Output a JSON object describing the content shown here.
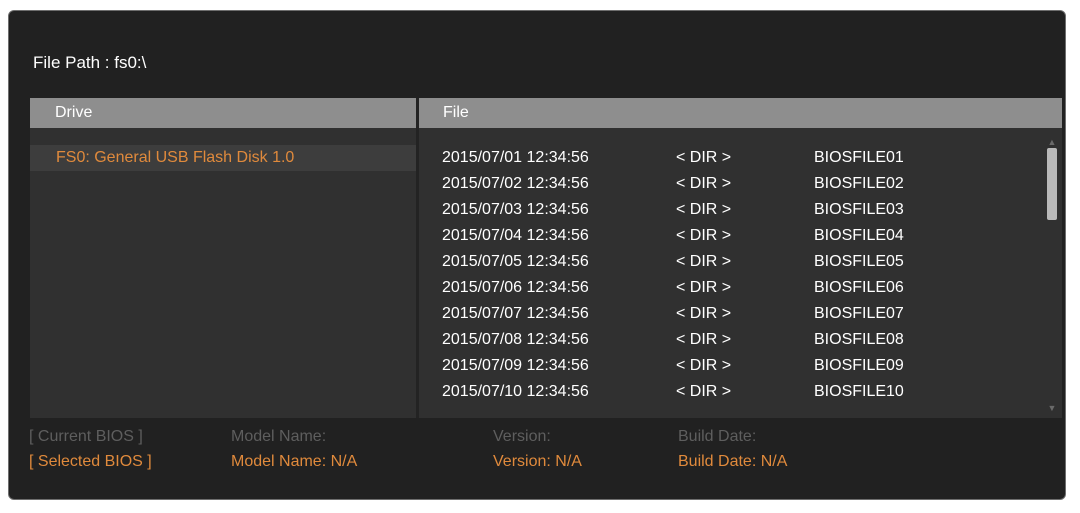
{
  "file_path": "File Path : fs0:\\",
  "headers": {
    "drive": "Drive",
    "file": "File"
  },
  "drives": [
    "FS0: General USB Flash Disk 1.0"
  ],
  "files": [
    {
      "date": "2015/07/01 12:34:56",
      "type": "< DIR >",
      "name": "BIOSFILE01"
    },
    {
      "date": "2015/07/02 12:34:56",
      "type": "< DIR >",
      "name": "BIOSFILE02"
    },
    {
      "date": "2015/07/03 12:34:56",
      "type": "< DIR >",
      "name": "BIOSFILE03"
    },
    {
      "date": "2015/07/04 12:34:56",
      "type": "< DIR >",
      "name": "BIOSFILE04"
    },
    {
      "date": "2015/07/05 12:34:56",
      "type": "< DIR >",
      "name": "BIOSFILE05"
    },
    {
      "date": "2015/07/06 12:34:56",
      "type": "< DIR >",
      "name": "BIOSFILE06"
    },
    {
      "date": "2015/07/07 12:34:56",
      "type": "< DIR >",
      "name": "BIOSFILE07"
    },
    {
      "date": "2015/07/08 12:34:56",
      "type": "< DIR >",
      "name": "BIOSFILE08"
    },
    {
      "date": "2015/07/09 12:34:56",
      "type": "< DIR >",
      "name": "BIOSFILE09"
    },
    {
      "date": "2015/07/10 12:34:56",
      "type": "< DIR >",
      "name": "BIOSFILE10"
    }
  ],
  "current_bios": {
    "label": "[ Current BIOS  ]",
    "model": "Model Name:",
    "version": "Version:",
    "build_date": "Build Date:"
  },
  "selected_bios": {
    "label": "[ Selected BIOS ]",
    "model": "Model Name: N/A",
    "version": "Version: N/A",
    "build_date": "Build Date: N/A"
  },
  "colors": {
    "accent": "#e08a3c",
    "background": "#212121",
    "panel": "#303030",
    "header": "#8e8e8e",
    "dim_text": "#5e5e5e"
  },
  "icons": {
    "scroll_up": "scroll-up-arrow-icon",
    "scroll_down": "scroll-down-arrow-icon"
  }
}
